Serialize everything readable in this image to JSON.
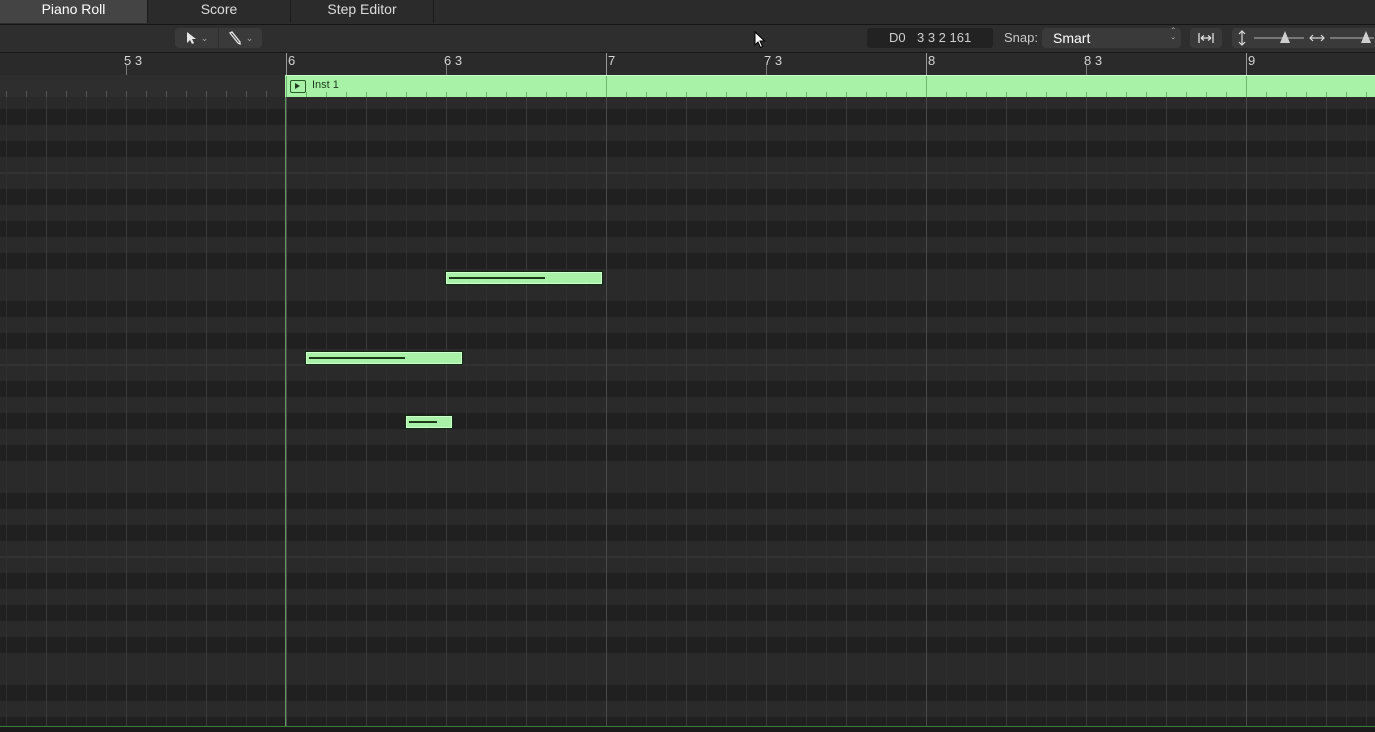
{
  "tabs": [
    {
      "label": "Piano Roll",
      "active": true
    },
    {
      "label": "Score",
      "active": false
    },
    {
      "label": "Step Editor",
      "active": false
    }
  ],
  "toolbar": {
    "left_tool_icon": "pointer-icon",
    "right_tool_icon": "pencil-icon",
    "position_note": "D0",
    "position_value": "3 3 2 161",
    "snap_label": "Snap:",
    "snap_value": "Smart",
    "fit_icon": "fit-to-window-icon",
    "vertical_zoom_icon": "vertical-zoom-icon",
    "horizontal_zoom_icon": "horizontal-zoom-icon",
    "vertical_zoom_level": 0.62,
    "horizontal_zoom_level": 0.8
  },
  "ruler": {
    "labels": [
      "5 3",
      "6",
      "6 3",
      "7",
      "7 3",
      "8",
      "8 3",
      "9"
    ]
  },
  "region": {
    "name": "Inst 1",
    "color": "#a7f2a7"
  },
  "notes": [
    {
      "start_bar": "6 3",
      "length_beats": 2,
      "velocity": 0.65
    },
    {
      "start_bar": "6 1 2",
      "length_beats": 2,
      "velocity": 0.65
    },
    {
      "start_bar": "6 2 3",
      "length_beats": 0.6,
      "velocity": 0.7
    }
  ],
  "colors": {
    "background": "#262626",
    "region_green": "#a7f2a7",
    "grid_line": "#333333"
  }
}
